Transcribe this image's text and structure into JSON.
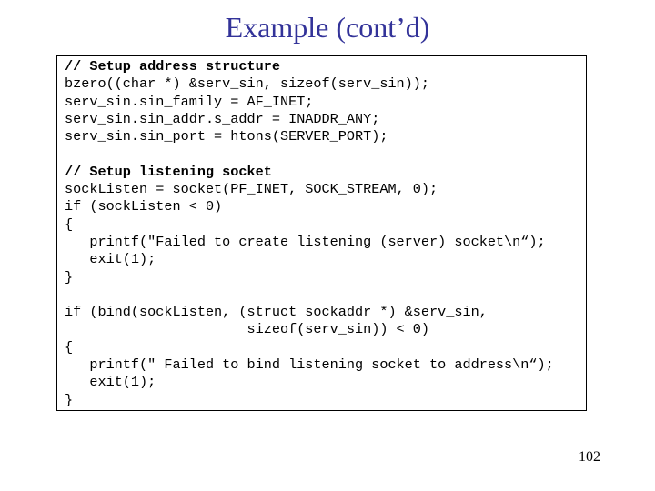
{
  "slide": {
    "title": "Example (cont’d)",
    "page_number": "102"
  },
  "code": {
    "block1": [
      {
        "text": "// Setup address structure",
        "comment": true
      },
      {
        "text": "bzero((char *) &serv_sin, sizeof(serv_sin));"
      },
      {
        "text": "serv_sin.sin_family = AF_INET;"
      },
      {
        "text": "serv_sin.sin_addr.s_addr = INADDR_ANY;"
      },
      {
        "text": "serv_sin.sin_port = htons(SERVER_PORT);"
      }
    ],
    "block2": [
      {
        "text": "// Setup listening socket",
        "comment": true
      },
      {
        "text": "sockListen = socket(PF_INET, SOCK_STREAM, 0);"
      },
      {
        "text": "if (sockListen < 0)"
      },
      {
        "text": "{"
      },
      {
        "text": "   printf(\"Failed to create listening (server) socket\\n“);"
      },
      {
        "text": "   exit(1);"
      },
      {
        "text": "}"
      }
    ],
    "block3": [
      {
        "text": "if (bind(sockListen, (struct sockaddr *) &serv_sin,"
      },
      {
        "text": "                      sizeof(serv_sin)) < 0)"
      },
      {
        "text": "{"
      },
      {
        "text": "   printf(\" Failed to bind listening socket to address\\n“);"
      },
      {
        "text": "   exit(1);"
      },
      {
        "text": "}"
      }
    ]
  }
}
